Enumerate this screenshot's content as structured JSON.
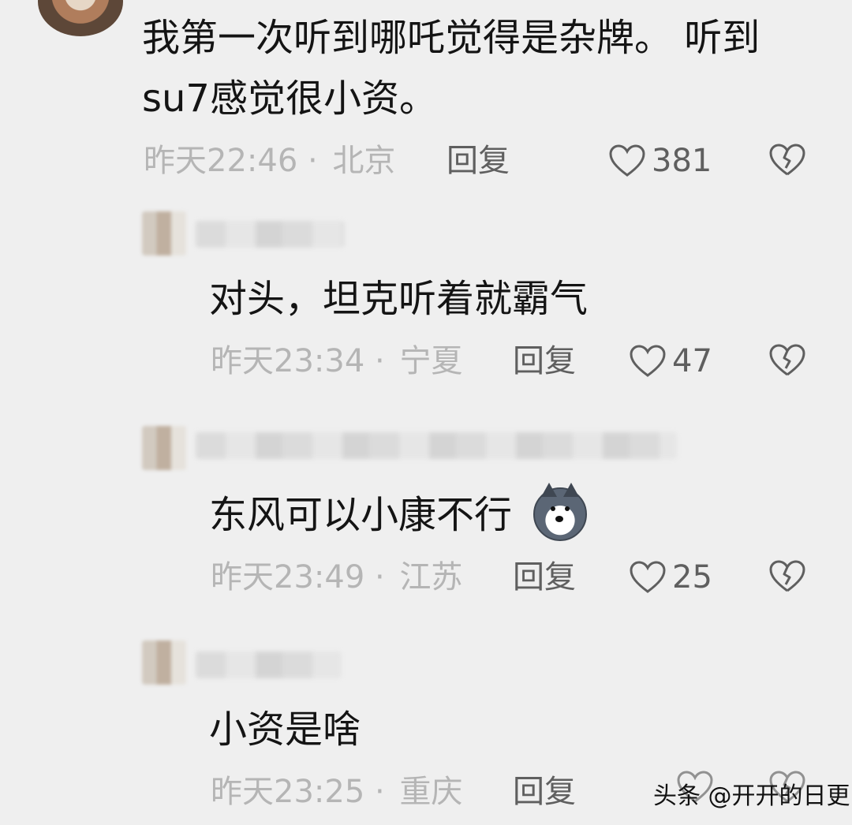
{
  "comments": [
    {
      "text_line1": "我第一次听到哪吒觉得是杂牌。 听到",
      "text_line2": "su7感觉很小资。",
      "time": "昨天22:46",
      "location": "北京",
      "reply_label": "回复",
      "likes": "381"
    },
    {
      "text": "对头，坦克听着就霸气",
      "time": "昨天23:34",
      "location": "宁夏",
      "reply_label": "回复",
      "likes": "47"
    },
    {
      "text": "东风可以小康不行",
      "time": "昨天23:49",
      "location": "江苏",
      "reply_label": "回复",
      "likes": "25"
    },
    {
      "text": "小资是啥",
      "time": "昨天23:25",
      "location": "重庆",
      "reply_label": "回复"
    }
  ],
  "separator": "·",
  "watermark": "头条 @开开的日更",
  "icons": {
    "like": "heart-outline-icon",
    "dislike": "broken-heart-icon",
    "emoji": "doge-emoji-icon"
  }
}
